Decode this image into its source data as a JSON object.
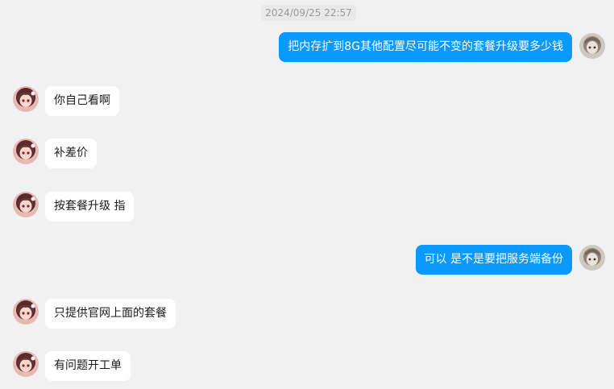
{
  "timestamp": "2024/09/25 22:57",
  "messages": [
    {
      "side": "out",
      "text": "把内存扩到8G其他配置尽可能不变的套餐升级要多少钱",
      "avatar": "self-avatar-icon"
    },
    {
      "side": "in",
      "text": "你自己看啊",
      "avatar": "contact-avatar-icon"
    },
    {
      "side": "in",
      "text": "补差价",
      "avatar": "contact-avatar-icon"
    },
    {
      "side": "in",
      "text": "按套餐升级 指",
      "avatar": "contact-avatar-icon"
    },
    {
      "side": "out",
      "text": "可以 是不是要把服务端备份",
      "avatar": "self-avatar-icon"
    },
    {
      "side": "in",
      "text": "只提供官网上面的套餐",
      "avatar": "contact-avatar-icon"
    },
    {
      "side": "in",
      "text": "有问题开工单",
      "avatar": "contact-avatar-icon"
    }
  ],
  "colors": {
    "background": "#f1f1f1",
    "outgoing_bubble": "#0a99ff",
    "incoming_bubble": "#ffffff"
  }
}
